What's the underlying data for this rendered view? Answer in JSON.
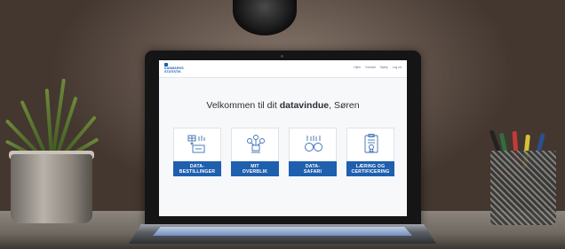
{
  "site": {
    "logo_line1": "DANMARKS",
    "logo_line2": "STATISTIK"
  },
  "nav": [
    "Hjem",
    "Kontakt",
    "Hjælp",
    "Log ud"
  ],
  "welcome": {
    "prefix": "Velkommen til dit ",
    "emphasis": "datavindue",
    "suffix": ", Søren"
  },
  "cards": [
    {
      "line1": "DATA-",
      "line2": "BESTILLINGER",
      "icon": "data-orders-icon"
    },
    {
      "line1": "MIT",
      "line2": "OVERBLIK",
      "icon": "overview-icon"
    },
    {
      "line1": "DATA-",
      "line2": "SAFARI",
      "icon": "binoculars-icon"
    },
    {
      "line1": "LÆRING OG",
      "line2": "CERTIFICERING",
      "icon": "certificate-icon"
    }
  ],
  "colors": {
    "brand": "#1e5fae",
    "screen_bg": "#f7f8fa",
    "icon_stroke": "#3b6fb3"
  }
}
